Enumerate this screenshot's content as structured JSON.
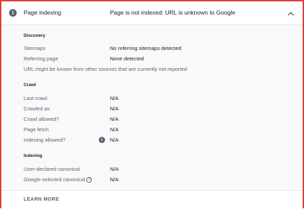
{
  "header": {
    "icon": "info-icon",
    "title": "Page indexing",
    "status": "Page is not indexed: URL is unknown to Google",
    "collapse_icon": "chevron-up-icon"
  },
  "discovery": {
    "heading": "Discovery",
    "sitemaps_label": "Sitemaps",
    "sitemaps_value": "No referring sitemaps detected",
    "referring_label": "Referring page",
    "referring_value": "None detected",
    "note": "URL might be known from other sources that are currently not reported"
  },
  "crawl": {
    "heading": "Crawl",
    "rows": [
      {
        "label": "Last crawl",
        "value": "N/A"
      },
      {
        "label": "Crawled as",
        "value": "N/A"
      },
      {
        "label": "Crawl allowed?",
        "value": "N/A"
      },
      {
        "label": "Page fetch",
        "value": "N/A"
      },
      {
        "label": "Indexing allowed?",
        "value": "N/A"
      }
    ]
  },
  "indexing": {
    "heading": "Indexing",
    "rows": [
      {
        "label": "User-declared canonical",
        "value": "N/A"
      },
      {
        "label": "Google-selected canonical",
        "value": "N/A"
      }
    ]
  },
  "footer": {
    "learn_more": "LEARN MORE"
  },
  "colors": {
    "border": "#e53935",
    "panel": "#f8f9fa",
    "muted_text": "#5f6368",
    "text": "#202124"
  }
}
